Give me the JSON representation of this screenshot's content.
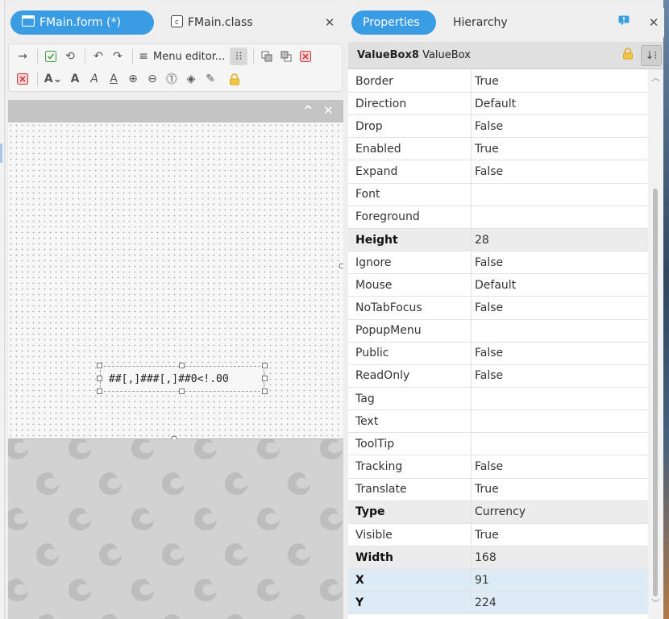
{
  "tabs_left": {
    "form_tab": "FMain.form (*)",
    "class_tab": "FMain.class"
  },
  "tabs_right": {
    "properties": "Properties",
    "hierarchy": "Hierarchy"
  },
  "toolbar": {
    "menu_editor": "Menu editor..."
  },
  "designer": {
    "valuebox_text": "##[,]###[,]##0<!.00"
  },
  "properties": {
    "control_name": "ValueBox8",
    "control_type": "ValueBox",
    "rows": [
      {
        "name": "Border",
        "value": "True"
      },
      {
        "name": "Direction",
        "value": "Default"
      },
      {
        "name": "Drop",
        "value": "False"
      },
      {
        "name": "Enabled",
        "value": "True"
      },
      {
        "name": "Expand",
        "value": "False"
      },
      {
        "name": "Font",
        "value": ""
      },
      {
        "name": "Foreground",
        "value": ""
      },
      {
        "name": "Height",
        "value": "28"
      },
      {
        "name": "Ignore",
        "value": "False"
      },
      {
        "name": "Mouse",
        "value": "Default"
      },
      {
        "name": "NoTabFocus",
        "value": "False"
      },
      {
        "name": "PopupMenu",
        "value": ""
      },
      {
        "name": "Public",
        "value": "False"
      },
      {
        "name": "ReadOnly",
        "value": "False"
      },
      {
        "name": "Tag",
        "value": ""
      },
      {
        "name": "Text",
        "value": ""
      },
      {
        "name": "ToolTip",
        "value": ""
      },
      {
        "name": "Tracking",
        "value": "False"
      },
      {
        "name": "Translate",
        "value": "True"
      },
      {
        "name": "Type",
        "value": "Currency"
      },
      {
        "name": "Visible",
        "value": "True"
      },
      {
        "name": "Width",
        "value": "168"
      },
      {
        "name": "X",
        "value": "91"
      },
      {
        "name": "Y",
        "value": "224"
      }
    ]
  },
  "colors": {
    "accent": "#3a9ce2",
    "selected_row": "#dcebf6",
    "modified_row": "#ececec",
    "lock": "#e0a820"
  }
}
